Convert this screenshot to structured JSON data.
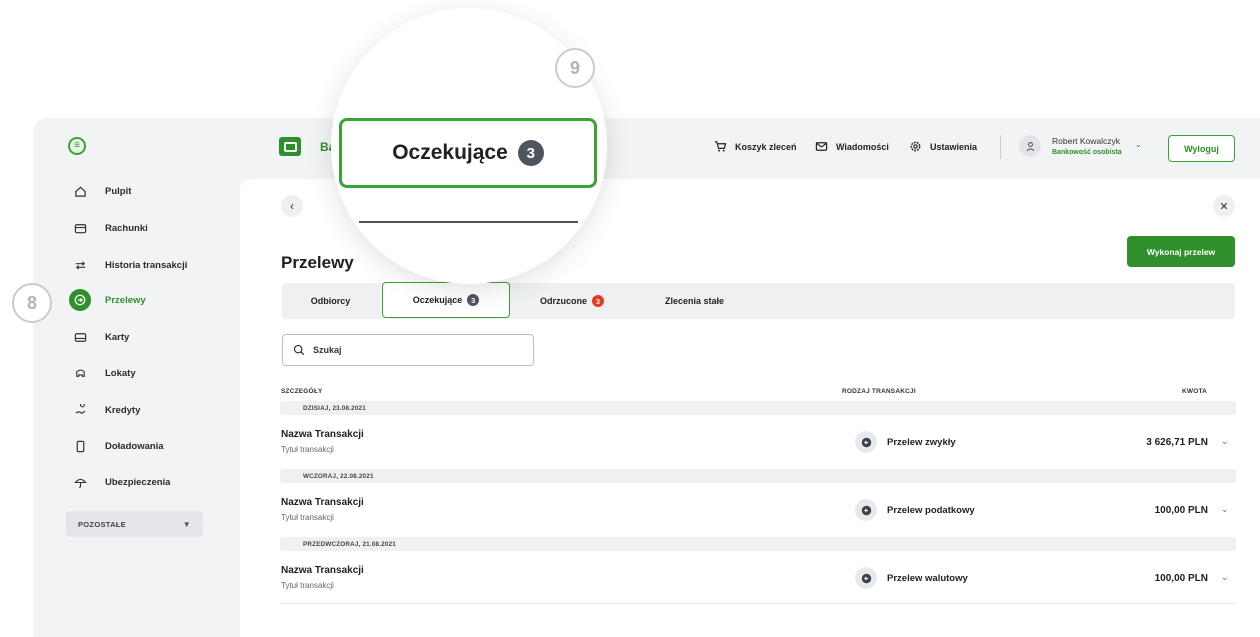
{
  "header": {
    "brand": "Ba",
    "cart": "Koszyk zleceń",
    "messages": "Wiadomości",
    "settings": "Ustawienia",
    "user_name": "Robert Kowalczyk",
    "user_role": "Bankowość osobista",
    "logout": "Wyloguj"
  },
  "sidebar": {
    "items": [
      {
        "label": "Pulpit",
        "icon": "home-icon"
      },
      {
        "label": "Rachunki",
        "icon": "wallet-icon"
      },
      {
        "label": "Historia transakcji",
        "icon": "swap-arrows-icon"
      },
      {
        "label": "Przelewy",
        "icon": "arrow-right-circle-icon"
      },
      {
        "label": "Karty",
        "icon": "card-icon"
      },
      {
        "label": "Lokaty",
        "icon": "piggy-bank-icon"
      },
      {
        "label": "Kredyty",
        "icon": "loan-icon"
      },
      {
        "label": "Doładowania",
        "icon": "phone-icon"
      },
      {
        "label": "Ubezpieczenia",
        "icon": "umbrella-icon"
      }
    ],
    "more": "POZOSTAŁE"
  },
  "main": {
    "title": "Przelewy",
    "primary_action": "Wykonaj przelew",
    "tabs": [
      {
        "label": "Odbiorcy",
        "badge": ""
      },
      {
        "label": "Oczekujące",
        "badge": "3"
      },
      {
        "label": "Odrzucone",
        "badge": "3"
      },
      {
        "label": "Zlecenia stałe",
        "badge": ""
      }
    ],
    "search_placeholder": "Szukaj",
    "columns": {
      "details": "SZCZEGÓŁY",
      "type": "RODZAJ TRANSAKCJI",
      "amount": "KWOTA"
    },
    "groups": [
      {
        "date": "DZISIAJ, 23.08.2021",
        "name": "Nazwa Transakcji",
        "title": "Tytuł transakcji",
        "type": "Przelew zwykły",
        "amount": "3 626,71 PLN"
      },
      {
        "date": "WCZORAJ, 22.08.2021",
        "name": "Nazwa Transakcji",
        "title": "Tytuł transakcji",
        "type": "Przelew podatkowy",
        "amount": "100,00 PLN"
      },
      {
        "date": "PRZEDWCZORAJ, 21.08.2021",
        "name": "Nazwa Transakcji",
        "title": "Tytuł transakcji",
        "type": "Przelew walutowy",
        "amount": "100,00 PLN"
      }
    ]
  },
  "magnifier": {
    "label": "Oczekujące",
    "badge": "3"
  },
  "steps": {
    "sidebar_step": "8",
    "tab_step": "9"
  },
  "colors": {
    "accent": "#2f8f2a",
    "badge_gray": "#4f5560",
    "badge_red": "#e53a1f"
  }
}
